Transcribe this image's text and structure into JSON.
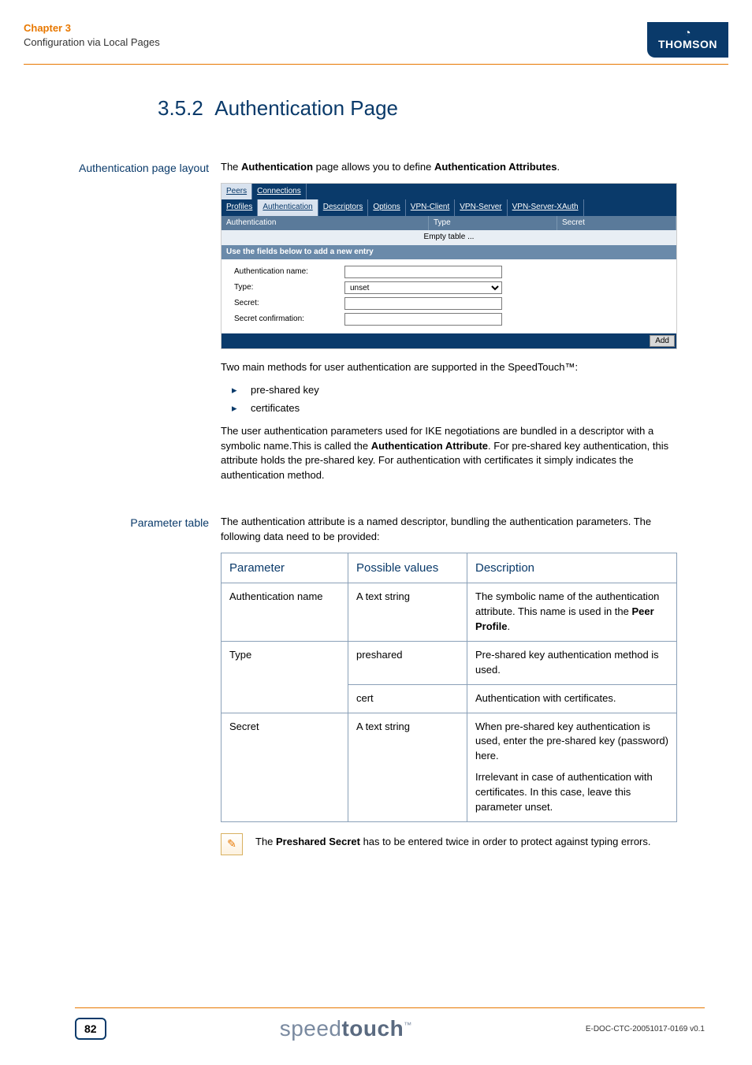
{
  "header": {
    "chapter": "Chapter 3",
    "subtitle": "Configuration via Local Pages",
    "brand": "THOMSON"
  },
  "section": {
    "number": "3.5.2",
    "title": "Authentication Page"
  },
  "block1": {
    "side": "Authentication page layout",
    "intro_pre": "The ",
    "intro_b1": "Authentication",
    "intro_mid": " page allows you to define ",
    "intro_b2": "Authentication Attributes",
    "intro_post": ".",
    "ui": {
      "tabs1": [
        "Peers",
        "Connections"
      ],
      "tabs2": [
        "Profiles",
        "Authentication",
        "Descriptors",
        "Options",
        "VPN-Client",
        "VPN-Server",
        "VPN-Server-XAuth"
      ],
      "active_tab1": "Peers",
      "active_tab2": "Authentication",
      "cols": {
        "auth": "Authentication",
        "type": "Type",
        "secret": "Secret"
      },
      "empty": "Empty table ...",
      "subhead": "Use the fields below to add a new entry",
      "form": {
        "name_label": "Authentication name:",
        "type_label": "Type:",
        "type_value": "unset",
        "secret_label": "Secret:",
        "confirm_label": "Secret confirmation:"
      },
      "add": "Add"
    },
    "after1": "Two main methods for user authentication are supported in the SpeedTouch™:",
    "bullets": [
      "pre-shared key",
      "certificates"
    ],
    "after2_pre": "The user authentication parameters used for IKE negotiations are bundled in a descriptor with a symbolic name.This is called the ",
    "after2_b": "Authentication Attribute",
    "after2_post": ". For pre-shared key authentication, this attribute holds the pre-shared key. For authentication with certificates it simply indicates the authentication method."
  },
  "block2": {
    "side": "Parameter table",
    "intro": "The authentication attribute is a named descriptor, bundling the authentication parameters. The following data need to be provided:",
    "headers": {
      "param": "Parameter",
      "values": "Possible values",
      "desc": "Description"
    },
    "rows": {
      "r1": {
        "param": "Authentication name",
        "value": "A text string",
        "desc_pre": "The symbolic name of the authentication attribute. This name is used in the ",
        "desc_b": "Peer Profile",
        "desc_post": "."
      },
      "r2a": {
        "param": "Type",
        "value": "preshared",
        "desc": "Pre-shared key authentication method is used."
      },
      "r2b": {
        "value": "cert",
        "desc": "Authentication with certificates."
      },
      "r3": {
        "param": "Secret",
        "value": "A text string",
        "desc1": "When pre-shared key authentication is used, enter the pre-shared key (password) here.",
        "desc2": "Irrelevant in case of authentication with certificates. In this case, leave this parameter unset."
      }
    },
    "note_pre": "The ",
    "note_b": "Preshared Secret",
    "note_post": " has to be entered twice in order to protect against typing errors."
  },
  "footer": {
    "page": "82",
    "logo_light": "speed",
    "logo_bold": "touch",
    "logo_tm": "™",
    "docid": "E-DOC-CTC-20051017-0169 v0.1"
  }
}
